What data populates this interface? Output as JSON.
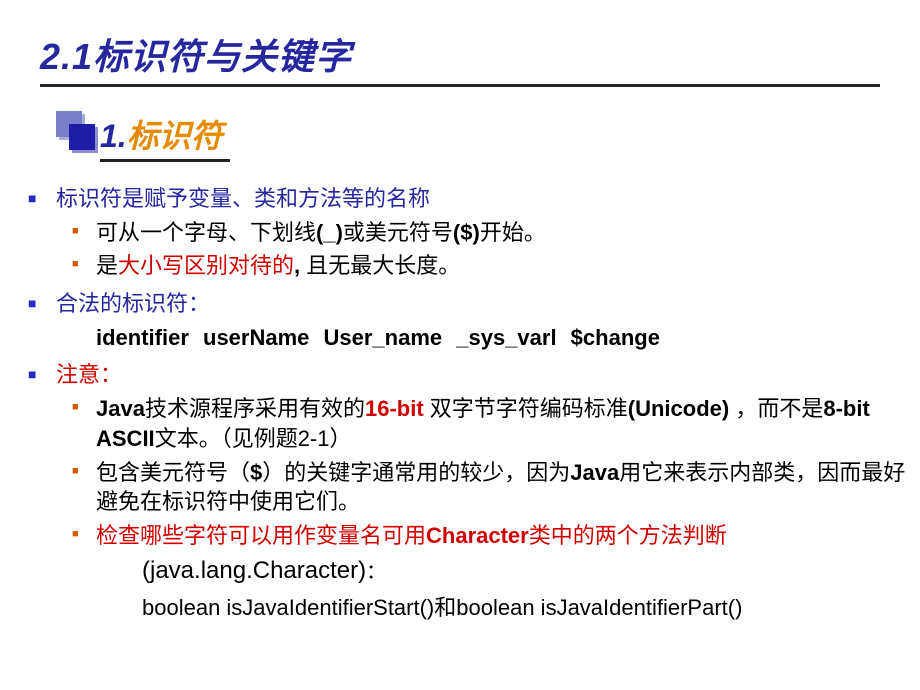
{
  "heading": "2.1标识符与关键字",
  "subheading": {
    "num": "1.",
    "text": "标识符"
  },
  "b1": {
    "title": "标识符是赋予变量、类和方法等的名称",
    "s1": {
      "a": "可从一个字母、下划线",
      "b": "(_)",
      "c": "或美元符号",
      "d": "($)",
      "e": "开始。"
    },
    "s2": {
      "a": "是",
      "b": "大小写区别对待的",
      "c": ", ",
      "d": "且无最大长度。"
    }
  },
  "b2": {
    "title": "合法的标识符：",
    "examples": "identifier  userName  User_name  _sys_varl  $change"
  },
  "b3": {
    "title": "注意：",
    "s1": {
      "a": "Java",
      "b": "技术源程序采用有效的",
      "c": "16-bit ",
      "d": "双字节字符编码标准",
      "e": "(Unicode) ",
      "f": "，而不是",
      "g": "8-bit ASCII",
      "h": "文本。（见例题2-1）"
    },
    "s2": {
      "a": "包含美元符号（",
      "b": "$",
      "c": "）的关键字通常用的较少，因为",
      "d": "Java",
      "e": "用它来表示内部类，因而最好避免在标识符中使用它们。"
    },
    "s3": {
      "a": "检查哪些字符可以用作变量名可用",
      "b": "Character",
      "c": "类中的两个方法判断"
    },
    "line1": {
      "a": "(java.lang.Character)",
      "b": "："
    },
    "line2": "boolean isJavaIdentifierStart()和boolean isJavaIdentifierPart()"
  }
}
